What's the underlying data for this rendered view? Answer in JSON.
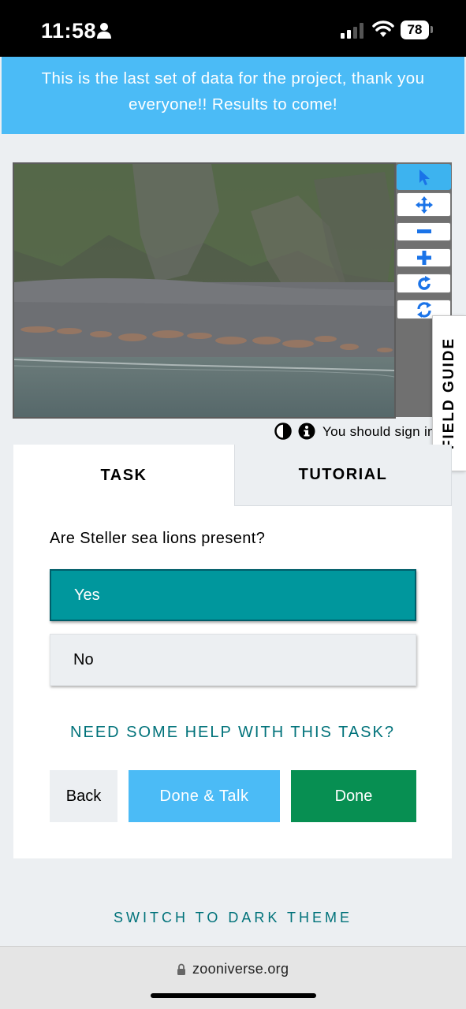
{
  "status_bar": {
    "time": "11:58",
    "battery": "78",
    "icons": [
      "person-icon",
      "cellular-signal-icon",
      "wifi-icon",
      "battery-icon"
    ]
  },
  "announcement": {
    "text": "This is the last set of data for the project, thank you everyone!! Results to come!"
  },
  "viewer": {
    "tools": [
      "pointer-icon",
      "move-icon",
      "zoom-out-icon",
      "zoom-in-icon",
      "rotate-icon",
      "reset-icon"
    ],
    "active_tool": "pointer-icon",
    "field_guide_label": "FIELD GUIDE",
    "sign_in_text": "You should sign in"
  },
  "task_panel": {
    "tabs": [
      {
        "label": "TASK",
        "selected": true
      },
      {
        "label": "TUTORIAL",
        "selected": false
      }
    ],
    "question": "Are Steller sea lions present?",
    "answers": [
      {
        "label": "Yes",
        "selected": true
      },
      {
        "label": "No",
        "selected": false
      }
    ],
    "help_link": "NEED SOME HELP WITH THIS TASK?",
    "buttons": {
      "back": "Back",
      "done_talk": "Done & Talk",
      "done": "Done"
    }
  },
  "footer": {
    "theme_switch": "SWITCH TO DARK THEME"
  },
  "browser": {
    "url": "zooniverse.org"
  },
  "colors": {
    "accent_blue": "#4bbbf6",
    "teal_selected": "#00979d",
    "done_green": "#078f52",
    "link_teal": "#00727a"
  }
}
